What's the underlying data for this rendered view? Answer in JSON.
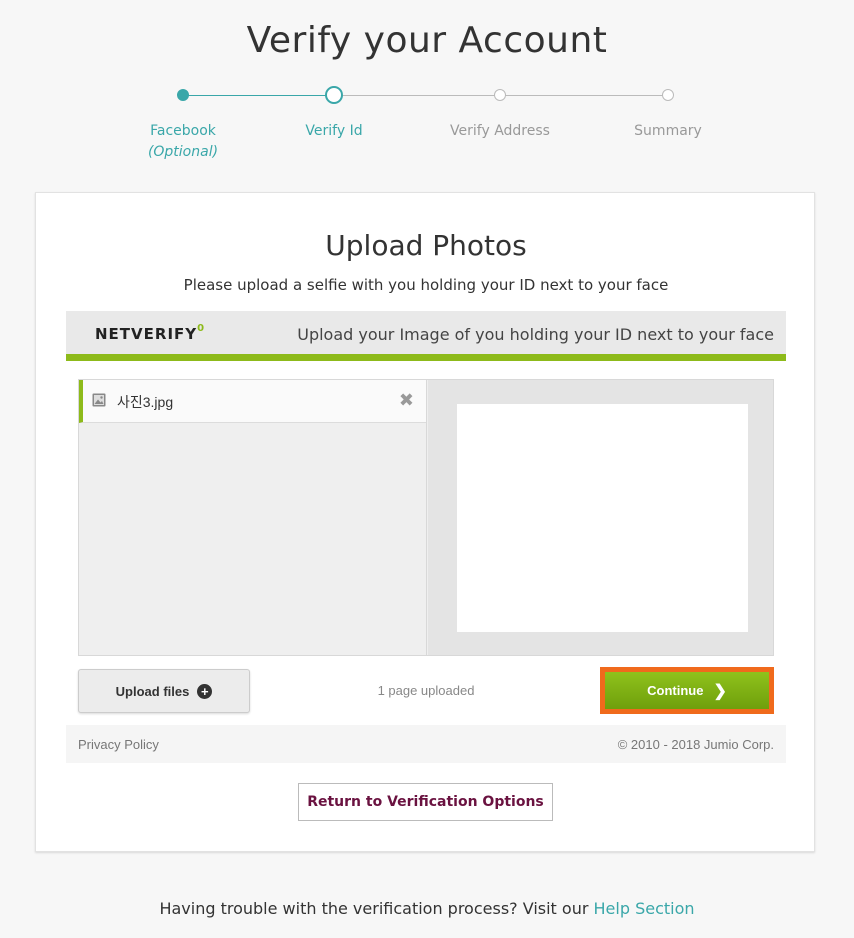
{
  "page": {
    "title": "Verify your Account"
  },
  "stepper": {
    "steps": [
      {
        "label": "Facebook",
        "sublabel": "(Optional)",
        "state": "completed"
      },
      {
        "label": "Verify Id",
        "state": "active"
      },
      {
        "label": "Verify Address",
        "state": "pending"
      },
      {
        "label": "Summary",
        "state": "pending"
      }
    ]
  },
  "card": {
    "title": "Upload Photos",
    "subtitle": "Please upload a selfie with you holding your ID next to your face"
  },
  "netverify": {
    "logo_text": "NETVERIFY",
    "logo_mark": "0",
    "caption": "Upload your Image of you holding your ID next to your face",
    "accent_color": "#8dba1a"
  },
  "uploads": {
    "files": [
      {
        "name": "사진3.jpg"
      }
    ],
    "upload_button_label": "Upload files",
    "status_text": "1 page uploaded",
    "continue_label": "Continue"
  },
  "footer": {
    "privacy_label": "Privacy Policy",
    "copyright": "© 2010 - 2018 Jumio Corp."
  },
  "return_button_label": "Return to Verification Options",
  "help": {
    "text": "Having trouble with the verification process? Visit our ",
    "link_label": "Help Section"
  },
  "colors": {
    "teal": "#3aa7a9",
    "highlight": "#f06a1c",
    "return_text": "#6a1240"
  }
}
